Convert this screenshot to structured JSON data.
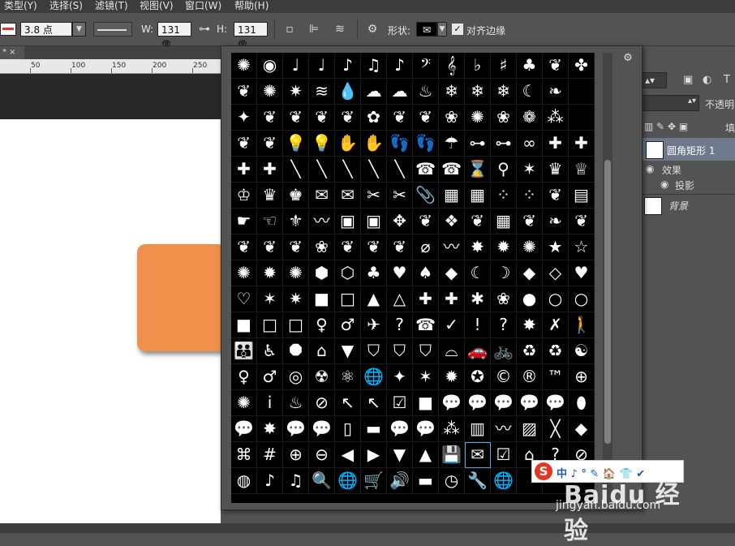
{
  "menu": [
    "类型(Y)",
    "选择(S)",
    "滤镜(T)",
    "视图(V)",
    "窗口(W)",
    "帮助(H)"
  ],
  "options": {
    "stroke_width": "3.8 点",
    "w_label": "W:",
    "w_value": "131 像",
    "h_label": "H:",
    "h_value": "131 像",
    "shape_label": "形状:",
    "align_label": "对齐边缘"
  },
  "document_tab": "* ×",
  "ruler_ticks": [
    "50",
    "100",
    "150",
    "200",
    "250"
  ],
  "right_panel": {
    "opacity_label": "不透明",
    "fill_label": "填",
    "layer_name": "圆角矩形 1",
    "effects_label": "效果",
    "drop_shadow_label": "投影",
    "background_label": "背景"
  },
  "shape_grid": [
    "✺",
    "◉",
    "♩",
    "♩",
    "♪",
    "♫",
    "♪",
    "𝄢",
    "𝄞",
    "♭",
    "♯",
    "♣",
    "❦",
    "✤",
    "❦",
    "✺",
    "✷",
    "≋",
    "💧",
    "☁",
    "☁",
    "♨",
    "❄",
    "❄",
    "❄",
    "☾",
    "❧",
    "",
    "✦",
    "❦",
    "❦",
    "❦",
    "❦",
    "✿",
    "❦",
    "❦",
    "❀",
    "✺",
    "❀",
    "❁",
    "⁂",
    "",
    "❦",
    "❦",
    "💡",
    "💡",
    "✋",
    "✋",
    "👣",
    "👣",
    "☂",
    "⊶",
    "⊶",
    "∞",
    "✚",
    "✚",
    "✚",
    "✚",
    "╲",
    "╲",
    "╲",
    "╲",
    "╲",
    "☎",
    "☎",
    "⌛",
    "⚲",
    "✶",
    "♛",
    "♕",
    "♔",
    "♛",
    "♚",
    "✉",
    "✉",
    "✂",
    "✂",
    "📎",
    "▦",
    "▦",
    "⁘",
    "⁘",
    "❦",
    "▤",
    "☛",
    "☜",
    "⚜",
    "〰",
    "▣",
    "▣",
    "✥",
    "❦",
    "❖",
    "❦",
    "▦",
    "❦",
    "❧",
    "❦",
    "❦",
    "❦",
    "❦",
    "❀",
    "❦",
    "❦",
    "❦",
    "⌀",
    "〰",
    "✸",
    "✹",
    "✺",
    "★",
    "☆",
    "✺",
    "✹",
    "✺",
    "⬢",
    "⬡",
    "♣",
    "♥",
    "♠",
    "◆",
    "☾",
    "☽",
    "◆",
    "◇",
    "♥",
    "♡",
    "✶",
    "✷",
    "■",
    "□",
    "▲",
    "△",
    "✚",
    "✚",
    "✱",
    "❀",
    "●",
    "○",
    "○",
    "■",
    "□",
    "□",
    "♀",
    "♂",
    "✈",
    "?",
    "☎",
    "✓",
    "!",
    "?",
    "✸",
    "✗",
    "🚶",
    "👪",
    "♿",
    "⯃",
    "⌂",
    "▼",
    "⛉",
    "⛉",
    "⛉",
    "⌓",
    "🚗",
    "🚲",
    "♻",
    "♻",
    "☯",
    "♀",
    "♂",
    "◎",
    "☢",
    "⚛",
    "🌐",
    "✦",
    "✶",
    "✹",
    "✪",
    "©",
    "®",
    "™",
    "⊕",
    "✺",
    "i",
    "♨",
    "⊘",
    "↖",
    "↖",
    "☑",
    "■",
    "💬",
    "💬",
    "💬",
    "💬",
    "💬",
    "⬮",
    "💬",
    "✸",
    "💬",
    "💬",
    "▯",
    "▬",
    "💬",
    "💬",
    "⁂",
    "▥",
    "〰",
    "▨",
    "╳",
    "◆",
    "⌘",
    "#",
    "⊕",
    "⊖",
    "◀",
    "▶",
    "▼",
    "▲",
    "💾",
    "✉",
    "☑",
    "⌂",
    "?",
    "⊘",
    "◍",
    "♪",
    "♫",
    "🔍",
    "🌐",
    "🛒",
    "🔊",
    "▬",
    "◷",
    "🔧",
    "🌐",
    "",
    "",
    ""
  ],
  "watermark": {
    "ime_s": "S",
    "ime_zh": "中 ♪ ° ✎ 🏠 👕 ✔",
    "brand": "Baidu 经验",
    "url": "jingyan.baidu.com"
  },
  "colors": {
    "orange_shape": "#f0904a",
    "selected_layer": "#6d7a8c",
    "canvas": "#ffffff"
  }
}
